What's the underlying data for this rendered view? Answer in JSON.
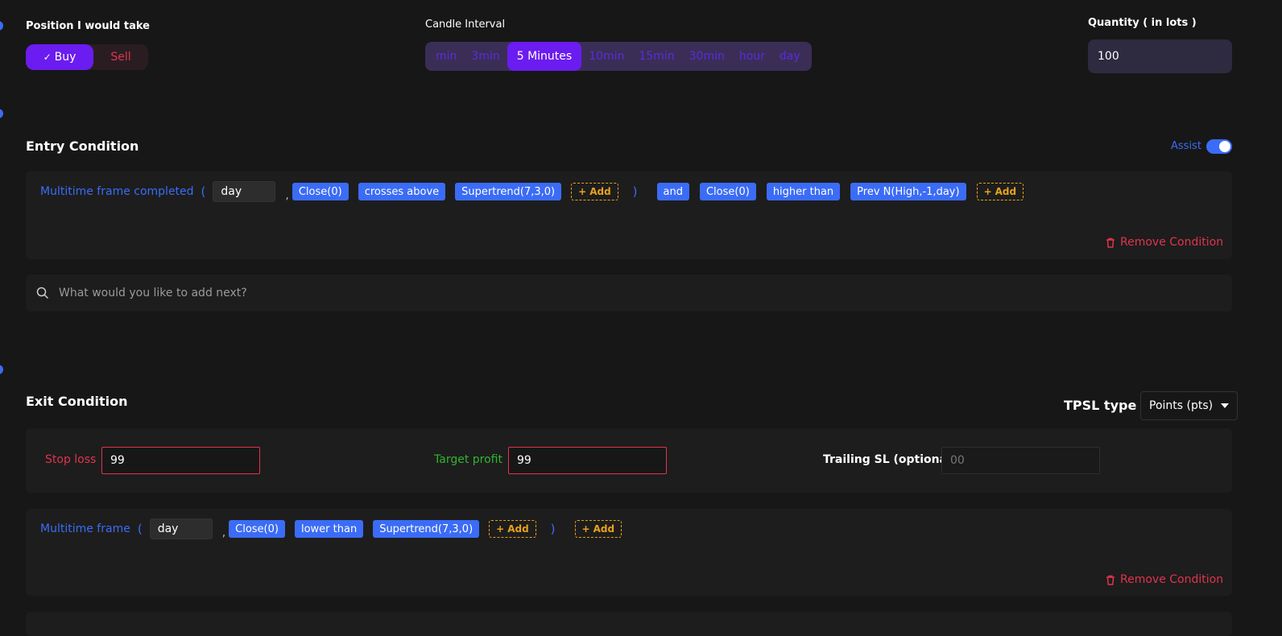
{
  "position": {
    "label": "Position I would take",
    "buy": "Buy",
    "sell": "Sell",
    "selected": "Buy"
  },
  "candle": {
    "label": "Candle Interval",
    "options": [
      "min",
      "3min",
      "5 Minutes",
      "10min",
      "15min",
      "30min",
      "hour",
      "day"
    ],
    "selected": "5 Minutes"
  },
  "quantity": {
    "label": "Quantity ( in lots )",
    "value": "100"
  },
  "entry": {
    "title": "Entry Condition",
    "assist_label": "Assist",
    "assist_on": true,
    "condition": {
      "keyword": "Multitime frame completed",
      "open_paren": "(",
      "timeframe": "day",
      "comma": ",",
      "chip1": "Close(0)",
      "op1": "crosses above",
      "chip2": "Supertrend(7,3,0)",
      "add1": "Add",
      "close_paren": ")",
      "joiner": "and",
      "chip3": "Close(0)",
      "op2": "higher than",
      "chip4": "Prev N(High,-1,day)",
      "add2": "Add"
    },
    "remove_label": "Remove Condition",
    "search_placeholder": "What would you like to add next?"
  },
  "exit": {
    "title": "Exit Condition",
    "tpsl_label": "TPSL type",
    "tpsl_value": "Points (pts)",
    "stop_loss_label": "Stop loss",
    "stop_loss_value": "99",
    "target_label": "Target profit",
    "target_value": "99",
    "trailing_label": "Trailing SL (optional)",
    "trailing_placeholder": "00",
    "condition": {
      "keyword": "Multitime frame",
      "open_paren": "(",
      "timeframe": "day",
      "comma": ",",
      "chip1": "Close(0)",
      "op1": "lower than",
      "chip2": "Supertrend(7,3,0)",
      "add1": "Add",
      "close_paren": ")",
      "add2": "Add"
    },
    "remove_label": "Remove Condition"
  },
  "colors": {
    "accent_purple": "#6b1cf0",
    "accent_blue": "#3b6cf6",
    "danger": "#e0344d",
    "warning": "#e8a21d",
    "success": "#2fb52f"
  }
}
